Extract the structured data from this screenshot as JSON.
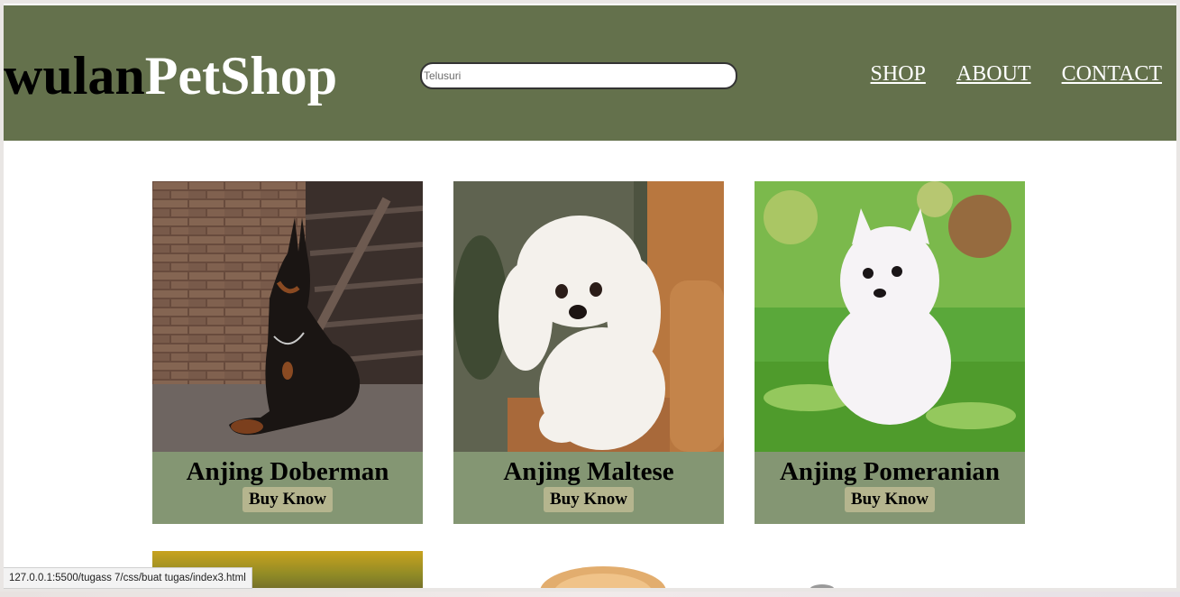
{
  "header": {
    "logo_part1": "wulan",
    "logo_part2": "PetShop",
    "search_placeholder": "Telusuri",
    "nav": [
      "SHOP",
      "ABOUT",
      "CONTACT"
    ],
    "background_color": "#64714c"
  },
  "products": [
    {
      "name": "Anjing Doberman",
      "button": "Buy Know"
    },
    {
      "name": "Anjing Maltese",
      "button": "Buy Know"
    },
    {
      "name": "Anjing Pomeranian",
      "button": "Buy Know"
    }
  ],
  "card_color": "#849673",
  "button_color": "#b5b58e",
  "status_url": "127.0.0.1:5500/tugass 7/css/buat tugas/index3.html"
}
